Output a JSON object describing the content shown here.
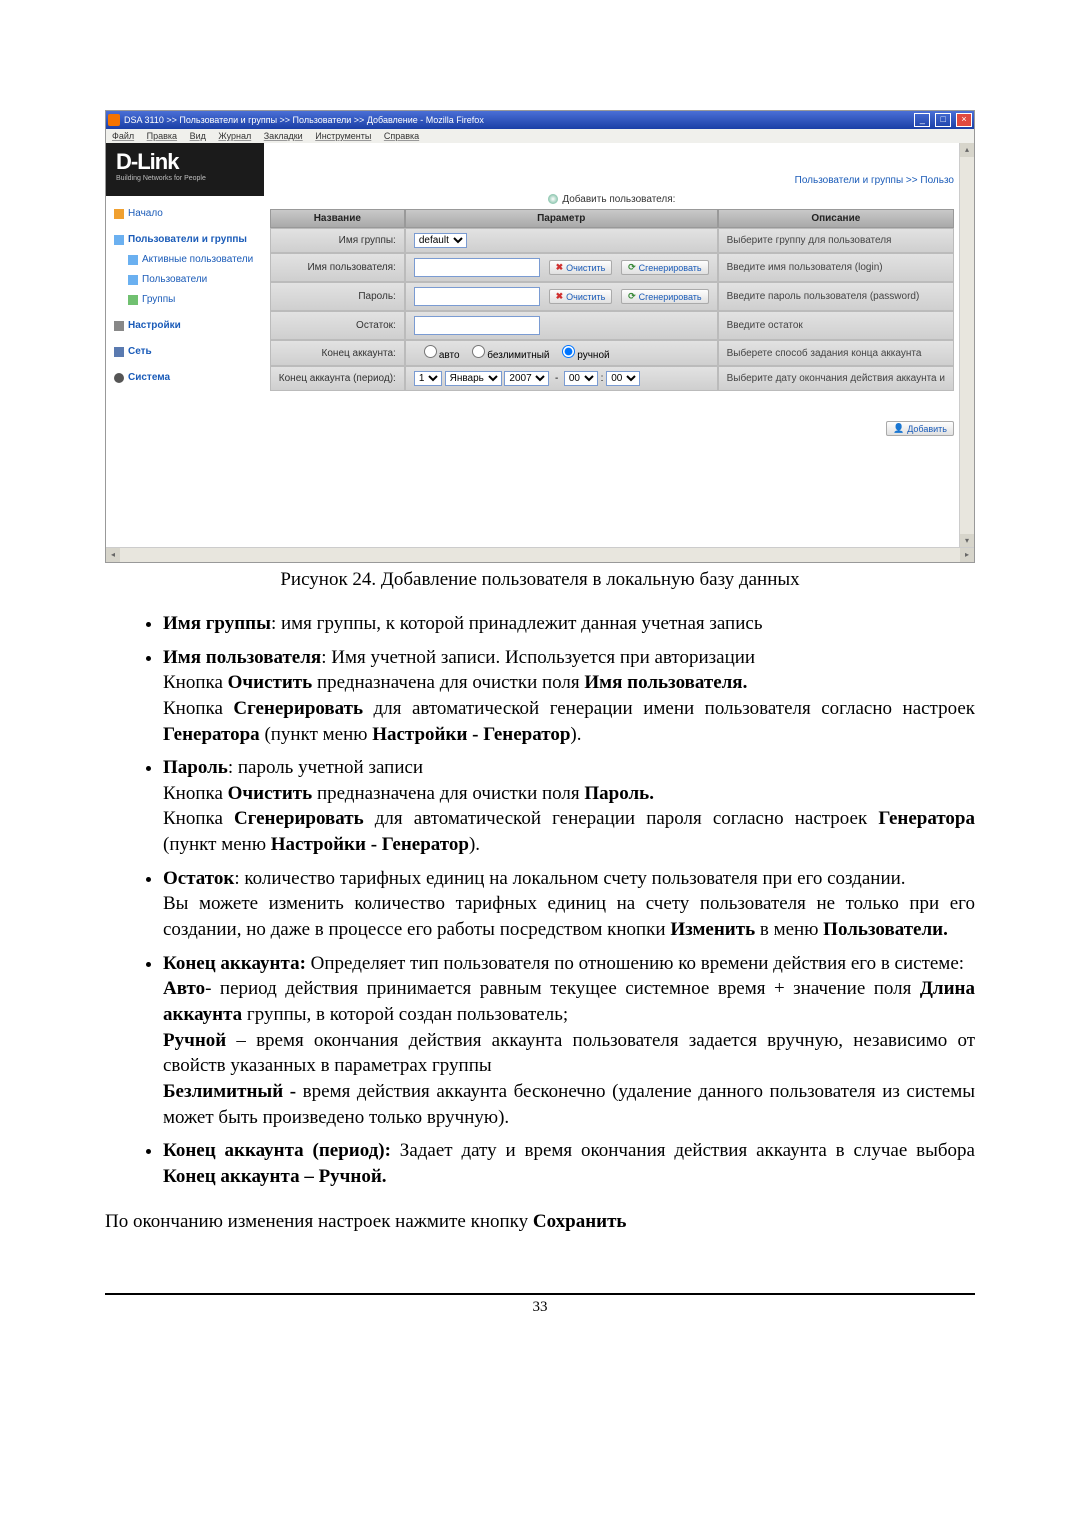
{
  "window": {
    "title": "DSA 3110 >> Пользователи и группы >> Пользователи >> Добавление - Mozilla Firefox",
    "min": "_",
    "max": "□",
    "close": "×"
  },
  "menu": {
    "file": "Файл",
    "edit": "Правка",
    "view": "Вид",
    "journal": "Журнал",
    "bookmarks": "Закладки",
    "tools": "Инструменты",
    "help": "Справка"
  },
  "brand": {
    "name": "D-Link",
    "tag": "Building Networks for People"
  },
  "crumb": "Пользователи и группы >> Пользо",
  "nav": {
    "home": "Начало",
    "ug": "Пользователи и группы",
    "active": "Активные пользователи",
    "users": "Пользователи",
    "groups": "Группы",
    "settings": "Настройки",
    "net": "Сеть",
    "system": "Система"
  },
  "subtitle": "Добавить пользователя:",
  "th": {
    "name": "Название",
    "param": "Параметр",
    "desc": "Описание"
  },
  "rows": {
    "group": {
      "label": "Имя группы:",
      "value": "default",
      "desc": "Выберите группу для пользователя"
    },
    "user": {
      "label": "Имя пользователя:",
      "desc": "Введите имя пользователя (login)"
    },
    "pass": {
      "label": "Пароль:",
      "desc": "Введите пароль пользователя (password)"
    },
    "bal": {
      "label": "Остаток:",
      "desc": "Введите остаток"
    },
    "end": {
      "label": "Конец аккаунта:",
      "opt_auto": "авто",
      "opt_unl": "безлимитный",
      "opt_man": "ручной",
      "desc": "Выберете способ задания конца аккаунта"
    },
    "endp": {
      "label": "Конец аккаунта (период):",
      "d": "1",
      "m": "Январь",
      "y": "2007",
      "hh": "00",
      "mm": "00",
      "desc": "Выберите дату окончания действия аккаунта и"
    }
  },
  "btns": {
    "clear": "Очистить",
    "gen": "Сгенерировать",
    "add": "Добавить"
  },
  "caption": "Рисунок 24. Добавление пользователя в локальную базу данных",
  "doc": {
    "li1a": "Имя группы",
    "li1b": ": имя группы, к которой принадлежит данная учетная запись",
    "li2a": "Имя пользователя",
    "li2b": ": Имя учетной записи. Используется при авторизации",
    "li2c": "Кнопка ",
    "li2d": "Очистить",
    "li2e": " предназначена для очистки поля ",
    "li2f": "Имя пользователя.",
    "li2g": "Кнопка ",
    "li2h": "Сгенерировать",
    "li2i": " для автоматической генерации имени пользователя согласно настроек ",
    "li2j": "Генератора",
    "li2k": " (пункт меню ",
    "li2l": "Настройки - Генератор",
    "li2m": ").",
    "li3a": "Пароль",
    "li3b": ": пароль учетной записи",
    "li3c": "Кнопка ",
    "li3d": "Очистить",
    "li3e": " предназначена для очистки поля ",
    "li3f": "Пароль.",
    "li3g": "Кнопка ",
    "li3h": "Сгенерировать",
    "li3i": " для автоматической генерации пароля согласно настроек ",
    "li3j": "Генератора",
    "li3k": " (пункт меню ",
    "li3l": "Настройки - Генератор",
    "li3m": ").",
    "li4a": "Остаток",
    "li4b": ": количество тарифных единиц на локальном счету пользователя при его создании.",
    "li4c": "Вы можете изменить количество тарифных единиц на счету пользователя не только при его создании, но даже в процессе его работы посредством кнопки ",
    "li4d": "Изменить",
    "li4e": " в меню ",
    "li4f": "Пользователи.",
    "li5a": "Конец аккаунта:",
    "li5b": " Определяет тип пользователя по отношению ко времени действия его в системе:",
    "li5c": "Авто",
    "li5d": "- период действия принимается равным текущее системное время + значение поля ",
    "li5e": "Длина аккаунта",
    "li5f": " группы, в которой создан пользователь;",
    "li5g": "Ручной",
    "li5h": " – время окончания действия аккаунта пользователя задается вручную, независимо от свойств указанных в параметрах группы",
    "li5i": "Безлимитный -",
    "li5j": " время действия аккаунта бесконечно (удаление данного пользователя из системы может быть произведено только вручную).",
    "li6a": "Конец аккаунта (период):",
    "li6b": " Задает дату и время окончания действия аккаунта в случае выбора  ",
    "li6c": "Конец аккаунта – Ручной.",
    "final": "По окончанию изменения настроек нажмите кнопку ",
    "final_b": "Сохранить"
  },
  "page_no": "33"
}
